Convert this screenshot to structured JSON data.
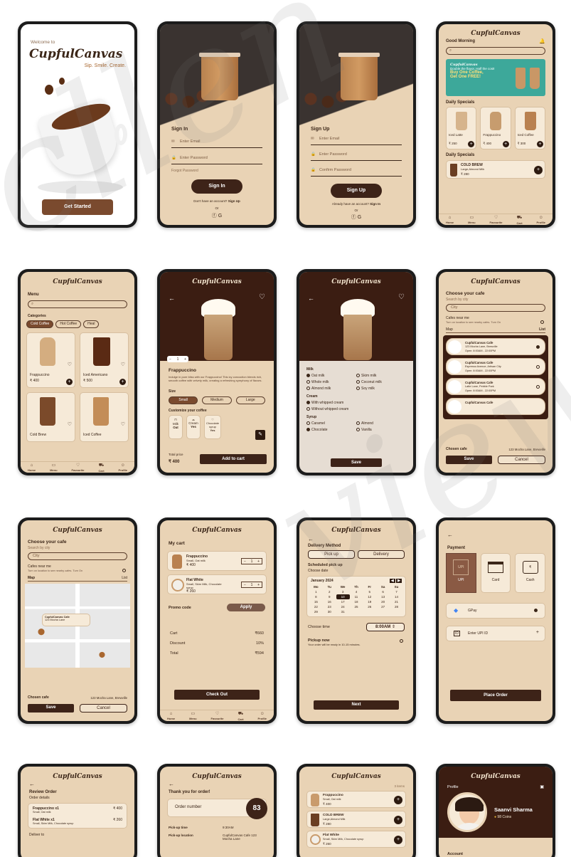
{
  "welcome": {
    "greeting": "Welcome to",
    "brand": "CupfulCanvas",
    "tagline": "Sip. Smile. Create.",
    "cta": "Get Started"
  },
  "brand": "CupfulCanvas",
  "signin": {
    "title": "Sign In",
    "email_ph": "Enter Email",
    "password_ph": "Enter Password",
    "forgot": "Forgot Password",
    "button": "Sign In",
    "no_account": "Don't have an account?",
    "signup_link": "Sign Up",
    "or": "Or"
  },
  "signup": {
    "title": "Sign Up",
    "email_ph": "Enter Email",
    "password_ph": "Enter Password",
    "confirm_ph": "Confirm Password",
    "button": "Sign Up",
    "have_account": "Already have an account?",
    "signin_link": "Sign In",
    "or": "Or"
  },
  "home": {
    "greeting": "Good Morning",
    "daily_specials": "Daily Specials",
    "banner_line1": "Double the flavor, Half the cost!",
    "banner_line2": "Buy One Coffee,",
    "banner_line3": "Get One FREE!",
    "specials": [
      {
        "name": "Iced Latte",
        "price": "₹ 250"
      },
      {
        "name": "Frappuccino",
        "price": "₹ 400"
      },
      {
        "name": "Iced Coffee",
        "price": "₹ 300"
      }
    ],
    "cold_brew": {
      "name": "COLD BREW",
      "sub": "Large,Almond Milk",
      "price": "₹ 280"
    }
  },
  "nav": {
    "home": "Home",
    "menu": "Menu",
    "favourite": "Favourite",
    "cart": "Cart",
    "profile": "Profile"
  },
  "menu": {
    "title": "Menu",
    "categories_label": "Categories",
    "categories": [
      "Cold Coffee",
      "Hot Coffee",
      "Heal"
    ],
    "items": [
      {
        "name": "Frappuccino",
        "price": "₹ 400"
      },
      {
        "name": "Iced Americano",
        "price": "₹ 500"
      },
      {
        "name": "Cold Brew",
        "price": ""
      },
      {
        "name": "Iced Coffee",
        "price": ""
      }
    ]
  },
  "product": {
    "name": "Frappuccino",
    "desc": "Indulge in pure bliss with our Frappuccino! This icy concoction blends rich, smooth coffee with velvety milk, creating a refreshing symphony of flavors.",
    "qty": "1",
    "size_label": "Size",
    "sizes": [
      "Small",
      "Medium",
      "Large"
    ],
    "customize_label": "Customize your coffee",
    "custom": [
      {
        "k": "Milk",
        "v": "Oat"
      },
      {
        "k": "Cream",
        "v": "Yes"
      },
      {
        "k": "Chocolate syrup",
        "v": "Yes"
      }
    ],
    "total_label": "Total price",
    "total": "₹ 400",
    "add": "Add to cart"
  },
  "customize": {
    "milk": "Milk",
    "milk_opts": [
      "Oat milk",
      "Skim milk",
      "Whole milk",
      "Coconut milk",
      "Almond milk",
      "Soy milk"
    ],
    "cream": "Cream",
    "cream_opts": [
      "With whipped cream",
      "Without whipped cream"
    ],
    "syrup": "Syrup",
    "syrup_opts": [
      "Caramel",
      "Almond",
      "Chocolate",
      "Vanilla"
    ],
    "save": "Save"
  },
  "cafe": {
    "title": "Choose your cafe",
    "search_label": "Search by city",
    "city_ph": "City",
    "near": "Cafes near me",
    "near_sub": "Turn on location to see nearby cafes. Turn On",
    "tab_map": "Map",
    "tab_list": "List",
    "list": [
      {
        "name": "CupfulCanvas Cafe",
        "addr": "123 Mocha Lane, Brewville",
        "hours": "Open: 8:00AM - 22:00PM"
      },
      {
        "name": "CupfulCanvas Cafe",
        "addr": "Espresso Avenue, Artisan City",
        "hours": "Open: 8:00AM - 22:00PM"
      },
      {
        "name": "CupfulCanvas Cafe",
        "addr": "Latte Lane, Pebble Park",
        "hours": "Open: 8:00AM - 22:00PM"
      },
      {
        "name": "CupfulCanvas Cafe",
        "addr": "",
        "hours": ""
      }
    ],
    "chosen_label": "Chosen cafe",
    "chosen": "123 Mocha Lane, Brewville",
    "save": "Save",
    "cancel": "Cancel",
    "map_pin": "CupfulCanvas Cafe",
    "map_pin_sub": "123 Mocha Lane"
  },
  "cart": {
    "title": "My cart",
    "items": [
      {
        "name": "Frappuccino",
        "sub": "Small, Oat milk",
        "price": "₹ 400",
        "qty": "1"
      },
      {
        "name": "Flat White",
        "sub": "Small, Skim Milk, Chocolate syrup",
        "price": "₹ 260",
        "qty": "1"
      }
    ],
    "promo": "Promo code",
    "apply": "Apply",
    "cart_label": "Cart",
    "cart_val": "₹660",
    "discount_label": "Discount",
    "discount_val": "10%",
    "total_label": "Total",
    "total_val": "₹594",
    "checkout": "Check Out"
  },
  "delivery": {
    "title": "Delivery Method",
    "pickup": "Pick up",
    "delivery": "Delivery",
    "scheduled": "Scheduled pick up",
    "choose_date": "Choose date",
    "month": "January 2024",
    "days": [
      "Mo",
      "Tu",
      "We",
      "Th",
      "Fr",
      "Sa",
      "Su"
    ],
    "weeks": [
      [
        "1",
        "2",
        "3",
        "4",
        "5",
        "6",
        "7"
      ],
      [
        "8",
        "9",
        "10",
        "11",
        "12",
        "13",
        "14"
      ],
      [
        "15",
        "16",
        "17",
        "18",
        "19",
        "20",
        "21"
      ],
      [
        "22",
        "23",
        "24",
        "25",
        "26",
        "27",
        "28"
      ],
      [
        "29",
        "30",
        "31",
        "",
        "",
        "",
        ""
      ]
    ],
    "choose_time": "Choose time",
    "time": "8:00AM",
    "pickup_now": "Pickup now",
    "pickup_now_sub": "Your order will be ready in 10-15 minutes.",
    "next": "Next"
  },
  "payment": {
    "title": "Payment",
    "methods": [
      "UPI",
      "Card",
      "Cash"
    ],
    "gpay": "GPay",
    "upi_ph": "Enter UPI ID",
    "place": "Place Order"
  },
  "review": {
    "title": "Review Order",
    "details": "Order details",
    "items": [
      {
        "name": "Frappuccino x1",
        "sub": "Small, Oat milk",
        "price": "₹ 400"
      },
      {
        "name": "Flat White x1",
        "sub": "Small, Skim Milk, Chocolate syrup",
        "price": "₹ 260"
      }
    ],
    "deliver_to": "Deliver to"
  },
  "thanks": {
    "title": "Thank you for order!",
    "order_label": "Order number",
    "order_no": "83",
    "pickup_time_label": "Pick-up time",
    "pickup_time": "9:30AM",
    "pickup_loc_label": "Pick-up location",
    "pickup_loc": "CupfulCanvas Cafe 123 Mocha Lane"
  },
  "favs": {
    "count": "3 items",
    "items": [
      {
        "name": "Frappuccino",
        "sub": "Small, Oat milk",
        "price": "₹ 400"
      },
      {
        "name": "COLD BREW",
        "sub": "Large,Almond Milk",
        "price": "₹ 280"
      },
      {
        "name": "Flat White",
        "sub": "Small, Skim Milk, Chocolate syrup",
        "price": "₹ 260"
      }
    ]
  },
  "profile": {
    "title": "Profile",
    "name": "Saanvi Sharma",
    "coins": "98 Coins",
    "account": "Account"
  },
  "colors": {
    "bg": "#e9d3b5",
    "dark": "#3d2318",
    "accent": "#a9672f"
  }
}
